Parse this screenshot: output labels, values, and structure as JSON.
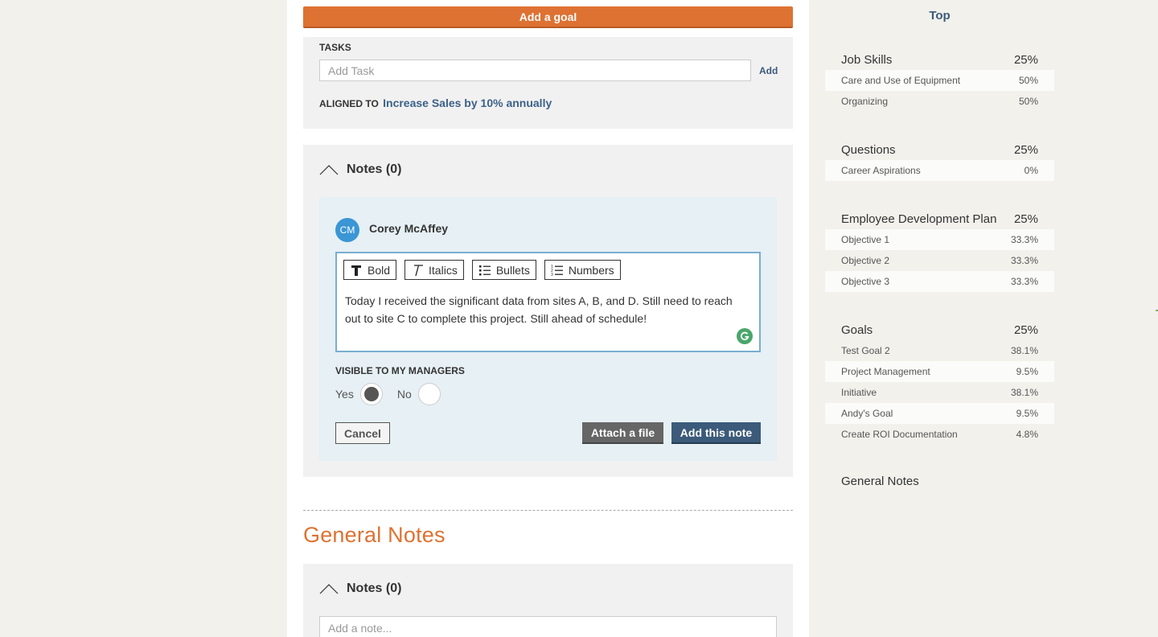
{
  "main": {
    "add_goal_label": "Add a goal",
    "tasks": {
      "label": "TASKS",
      "input_placeholder": "Add Task",
      "add_label": "Add",
      "aligned_prefix": "ALIGNED TO",
      "aligned_goal": "Increase Sales by 10% annually"
    },
    "notes": {
      "title": "Notes (0)",
      "author_initials": "CM",
      "author_name": "Corey McAffey",
      "toolbar": {
        "bold": "Bold",
        "italics": "Italics",
        "bullets": "Bullets",
        "numbers": "Numbers"
      },
      "text": "Today I received the significant data from sites A, B, and D. Still need to reach out to site C to complete this project. Still ahead of schedule!",
      "visibility_label": "VISIBLE TO MY MANAGERS",
      "yes_label": "Yes",
      "no_label": "No",
      "selected": "Yes",
      "cancel_label": "Cancel",
      "attach_label": "Attach a file",
      "add_note_label": "Add this note"
    },
    "general_notes": {
      "title": "General Notes",
      "notes_title": "Notes (0)",
      "input_placeholder": "Add a note..."
    }
  },
  "sidebar": {
    "top_label": "Top",
    "groups": [
      {
        "name": "Job Skills",
        "pct": "25%",
        "items": [
          {
            "label": "Care and Use of Equipment",
            "pct": "50%"
          },
          {
            "label": "Organizing",
            "pct": "50%"
          }
        ]
      },
      {
        "name": "Questions",
        "pct": "25%",
        "items": [
          {
            "label": "Career Aspirations",
            "pct": "0%"
          }
        ]
      },
      {
        "name": "Employee Development Plan",
        "pct": "25%",
        "items": [
          {
            "label": "Objective 1",
            "pct": "33.3%"
          },
          {
            "label": "Objective 2",
            "pct": "33.3%"
          },
          {
            "label": "Objective 3",
            "pct": "33.3%"
          }
        ]
      },
      {
        "name": "Goals",
        "pct": "25%",
        "items": [
          {
            "label": "Test Goal 2",
            "pct": "38.1%"
          },
          {
            "label": "Project Management",
            "pct": "9.5%"
          },
          {
            "label": "Initiative",
            "pct": "38.1%"
          },
          {
            "label": "Andy's Goal",
            "pct": "9.5%"
          },
          {
            "label": "Create ROI Documentation",
            "pct": "4.8%"
          }
        ]
      }
    ],
    "general_notes_label": "General Notes"
  }
}
